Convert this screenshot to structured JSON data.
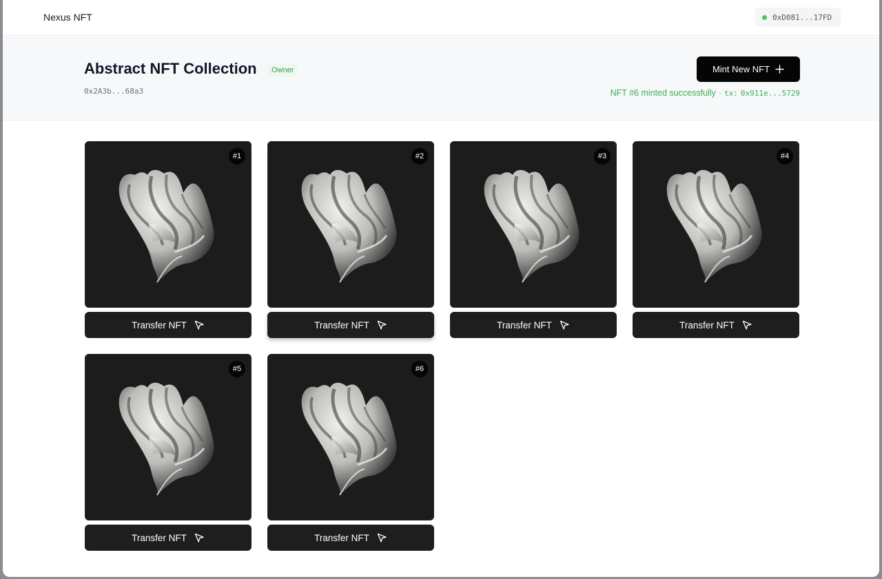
{
  "header": {
    "brand": "Nexus NFT",
    "wallet_address": "0xD081...17FD",
    "wallet_status_color": "#4cc36b"
  },
  "collection": {
    "title": "Abstract NFT Collection",
    "role_badge": "Owner",
    "contract_address": "0x2A3b...68a3",
    "mint_button_label": "Mint New NFT",
    "mint_button_icon": "plus-icon",
    "status_message": "NFT #6 minted successfully",
    "status_separator": "·",
    "tx_label": "tx:",
    "tx_hash": "0x911e...5729",
    "status_color": "#3fae55"
  },
  "nfts": [
    {
      "token_label": "#1",
      "action_label": "Transfer NFT",
      "action_icon": "send-icon"
    },
    {
      "token_label": "#2",
      "action_label": "Transfer NFT",
      "action_icon": "send-icon"
    },
    {
      "token_label": "#3",
      "action_label": "Transfer NFT",
      "action_icon": "send-icon"
    },
    {
      "token_label": "#4",
      "action_label": "Transfer NFT",
      "action_icon": "send-icon"
    },
    {
      "token_label": "#5",
      "action_label": "Transfer NFT",
      "action_icon": "send-icon"
    },
    {
      "token_label": "#6",
      "action_label": "Transfer NFT",
      "action_icon": "send-icon"
    }
  ]
}
